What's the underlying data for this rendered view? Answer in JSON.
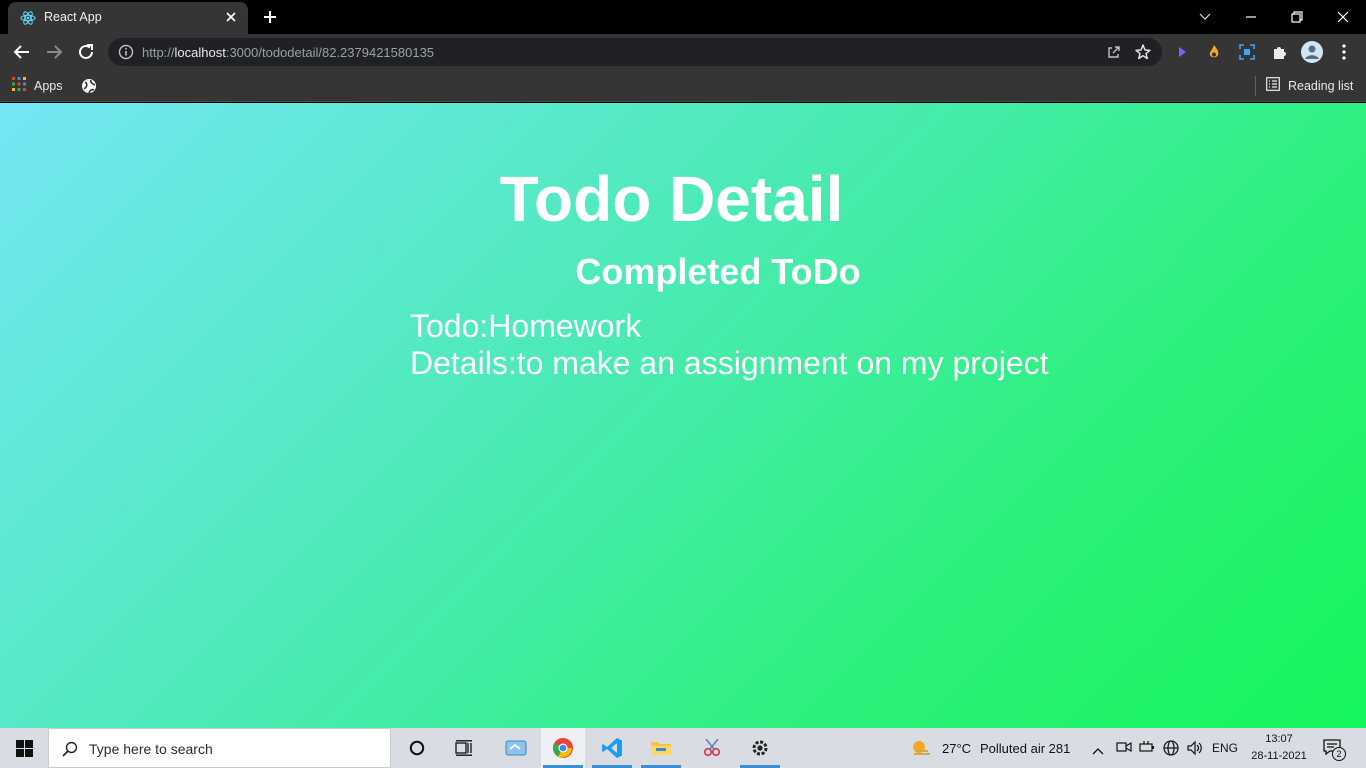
{
  "browser": {
    "tab": {
      "title": "React App",
      "favicon": "react-icon"
    },
    "url": {
      "scheme": "http://",
      "host": "localhost",
      "rest": ":3000/tododetail/82.2379421580135"
    },
    "bookmarks": {
      "apps_label": "Apps",
      "reading_list_label": "Reading list"
    }
  },
  "page": {
    "title": "Todo Detail",
    "status": "Completed ToDo",
    "todo_line": "Todo:Homework",
    "details_line": "Details:to make an assignment on my project"
  },
  "taskbar": {
    "search_placeholder": "Type here to search",
    "weather": {
      "temp": "27°C",
      "status": "Polluted air 281"
    },
    "language": "ENG",
    "time": "13:07",
    "date": "28-11-2021",
    "notification_count": "2"
  },
  "colors": {
    "gradient_start": "#74e6f4",
    "gradient_end": "#15f55a",
    "chrome_dark": "#353535",
    "taskbar_bg": "#d9dde3"
  }
}
